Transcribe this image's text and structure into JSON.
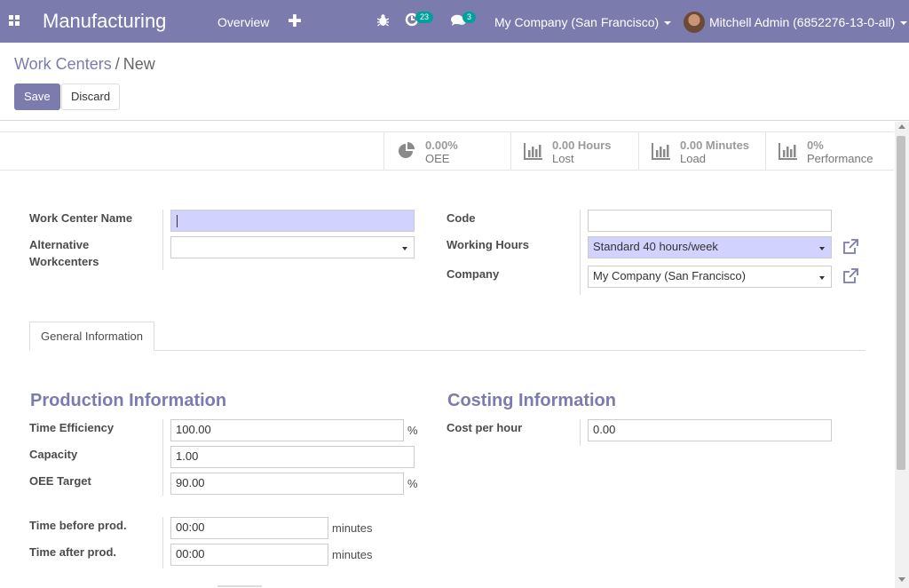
{
  "navbar": {
    "app_name": "Manufacturing",
    "menu_overview": "Overview",
    "plus_symbol": "✚",
    "activity_count": "23",
    "message_count": "3",
    "company": "My Company (San Francisco)",
    "user": "Mitchell Admin (6852276-13-0-all)",
    "bg_color": "#7c7bad",
    "badge_color": "#00a09d"
  },
  "breadcrumb": {
    "parent": "Work Centers",
    "separator": "/",
    "current": "New"
  },
  "buttons": {
    "save": "Save",
    "discard": "Discard"
  },
  "stats": [
    {
      "value": "0.00%",
      "label": "OEE",
      "icon": "pie-chart-icon"
    },
    {
      "value": "0.00 Hours",
      "label": "Lost",
      "icon": "bar-chart-icon"
    },
    {
      "value": "0.00 Minutes",
      "label": "Load",
      "icon": "bar-chart-icon"
    },
    {
      "value": "0%",
      "label": "Performance",
      "icon": "bar-chart-icon"
    }
  ],
  "form": {
    "name_label": "Work Center Name",
    "name_value": "",
    "alt_label_1": "Alternative",
    "alt_label_2": "Workcenters",
    "alt_value": "",
    "code_label": "Code",
    "code_value": "",
    "hours_label": "Working Hours",
    "hours_value": "Standard 40 hours/week",
    "company_label": "Company",
    "company_value": "My Company (San Francisco)"
  },
  "tabs": {
    "general": "General Information"
  },
  "production": {
    "title": "Production Information",
    "time_eff_label": "Time Efficiency",
    "time_eff_value": "100.00",
    "time_eff_unit": "%",
    "capacity_label": "Capacity",
    "capacity_value": "1.00",
    "oee_label": "OEE Target",
    "oee_value": "90.00",
    "oee_unit": "%",
    "before_label": "Time before prod.",
    "before_value": "00:00",
    "before_unit": "minutes",
    "after_label": "Time after prod.",
    "after_value": "00:00",
    "after_unit": "minutes"
  },
  "costing": {
    "title": "Costing Information",
    "cost_label": "Cost per hour",
    "cost_value": "0.00"
  }
}
